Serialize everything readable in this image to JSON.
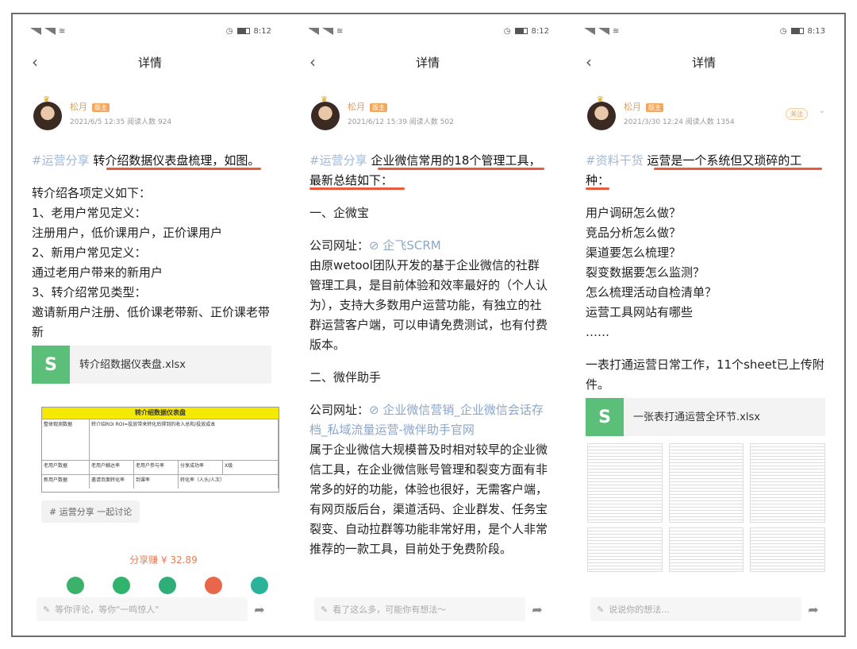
{
  "screens": [
    {
      "status": {
        "time": "8:12"
      },
      "nav": {
        "title": "详情"
      },
      "author": {
        "name": "松月",
        "badge": "版主",
        "meta": "2021/6/5 12:35  阅读人数 924"
      },
      "title_tag": "#运营分享",
      "title_text": "转介绍数据仪表盘梳理，如图。",
      "lines": [
        "转介绍各项定义如下：",
        "1、老用户常见定义：",
        "注册用户，低价课用户，正价课用户",
        "2、新用户常见定义：",
        "通过老用户带来的新用户",
        "3、转介绍常见类型：",
        "邀请新用户注册、低价课老带新、正价课老带新"
      ],
      "file": {
        "name": "转介绍数据仪表盘.xlsx"
      },
      "sheet": {
        "title": "转介绍数据仪表盘",
        "row1_label": "整体观测数据",
        "row1_text": "转介绍ROI  ROI=投放带来转化后得到的收入总和/投放成本",
        "row2_label": "老用户数据",
        "row2_cells": [
          "老用户触达率",
          "老用户参与率",
          "分享成功率",
          "X级"
        ],
        "row3_label": "新用户数据",
        "row3_cells": [
          "邀请页面转化率",
          "到课率",
          "转化率（人头/人次）"
        ]
      },
      "topic": "# 运营分享 一起讨论",
      "reward": "分享赚 ¥ 32.89",
      "comment": "等你评论，等你\"一鸣惊人\""
    },
    {
      "status": {
        "time": "8:12"
      },
      "nav": {
        "title": "详情"
      },
      "author": {
        "name": "松月",
        "badge": "版主",
        "meta": "2021/6/12 15:39  阅读人数 502"
      },
      "title_tag": "#运营分享",
      "title_text": "企业微信常用的18个管理工具，最新总结如下：",
      "sections": [
        {
          "heading": "一、企微宝",
          "site_label": "公司网址：",
          "site_link": "企飞SCRM",
          "desc": "由原wetool团队开发的基于企业微信的社群管理工具，是目前体验和效率最好的（个人认为），支持大多数用户运营功能，有独立的社群运营客户端，可以申请免费测试，也有付费版本。"
        },
        {
          "heading": "二、微伴助手",
          "site_label": "公司网址：",
          "site_link": "企业微信营销_企业微信会话存档_私域流量运营-微伴助手官网",
          "desc": "属于企业微信大规模普及时相对较早的企业微信工具，在企业微信账号管理和裂变方面有非常多的好的功能，体验也很好，无需客户端，有网页版后台，渠道活码、企业群发、任务宝裂变、自动拉群等功能非常好用，是个人非常推荐的一款工具，目前处于免费阶段。"
        }
      ],
      "comment": "看了这么多，可能你有想法～"
    },
    {
      "status": {
        "time": "8:13"
      },
      "nav": {
        "title": "详情"
      },
      "author": {
        "name": "松月",
        "badge": "版主",
        "meta": "2021/3/30 12:24  阅读人数 1354",
        "follow": "关注"
      },
      "title_tag": "#资料干货",
      "title_text": "运营是一个系统但又琐碎的工种：",
      "lines": [
        "用户调研怎么做？",
        "竞品分析怎么做？",
        "渠道要怎么梳理？",
        "裂变数据要怎么监测？",
        "怎么梳理活动自检清单？",
        "运营工具网站有哪些",
        "……"
      ],
      "summary": "一表打通运营日常工作，11个sheet已上传附件。",
      "file": {
        "name": "一张表打通运营全环节.xlsx"
      },
      "comment": "说说你的想法..."
    }
  ]
}
